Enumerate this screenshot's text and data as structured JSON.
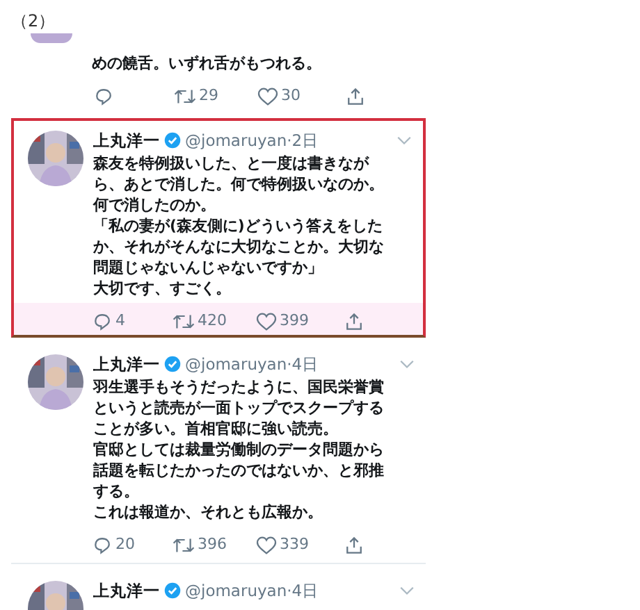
{
  "caption": "（2）",
  "tweets": [
    {
      "partial": true,
      "paragraphs": [
        "めの饒舌。いずれ舌がもつれる。"
      ],
      "retweets": "29",
      "likes": "30"
    },
    {
      "partial": false,
      "name": "上丸洋一",
      "verified": true,
      "handle": "@jomaruyan·2日",
      "paragraphs": [
        "森友を特例扱いした、と一度は書きながら、あとで消した。何で特例扱いなのか。何で消したのか。",
        "「私の妻が(森友側に)どういう答えをしたか、それがそんなに大切なことか。大切な問題じゃないんじゃないですか」",
        "大切です、すごく。"
      ],
      "replies": "4",
      "retweets": "420",
      "likes": "399",
      "highlighted": true
    },
    {
      "partial": false,
      "name": "上丸洋一",
      "verified": true,
      "handle": "@jomaruyan·4日",
      "paragraphs": [
        "羽生選手もそうだったように、国民栄誉賞というと読売が一面トップでスクープすることが多い。首相官邸に強い読売。",
        "官邸としては裁量労働制のデータ問題から話題を転じたかったのではないか、と邪推する。",
        "これは報道か、それとも広報か。"
      ],
      "replies": "20",
      "retweets": "396",
      "likes": "339",
      "highlighted": false
    },
    {
      "partial": false,
      "name": "上丸洋一",
      "verified": true,
      "handle": "@jomaruyan·4日",
      "highlighted": false
    }
  ]
}
